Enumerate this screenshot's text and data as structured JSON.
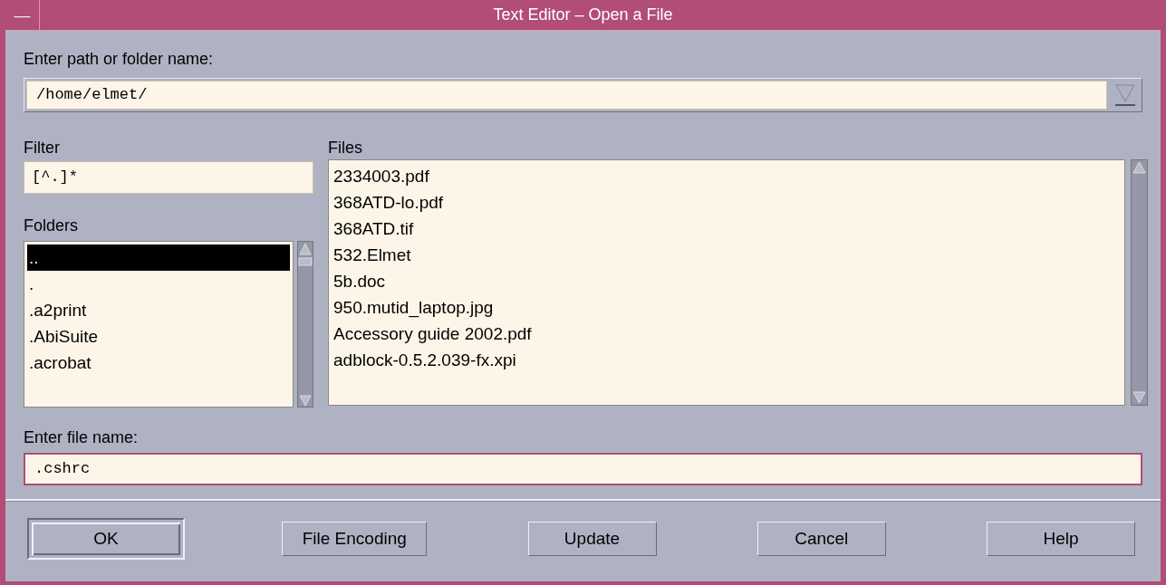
{
  "window": {
    "title": "Text Editor – Open a File",
    "menu_button": "—"
  },
  "path": {
    "label": "Enter path or folder name:",
    "value": "/home/elmet/"
  },
  "filter": {
    "label": "Filter",
    "value": "[^.]*"
  },
  "folders": {
    "label": "Folders",
    "items": [
      {
        "name": "..",
        "selected": true
      },
      {
        "name": ".",
        "selected": false
      },
      {
        "name": ".a2print",
        "selected": false
      },
      {
        "name": ".AbiSuite",
        "selected": false
      },
      {
        "name": ".acrobat",
        "selected": false
      }
    ]
  },
  "files": {
    "label": "Files",
    "items": [
      {
        "name": "2334003.pdf",
        "selected": false
      },
      {
        "name": "368ATD-lo.pdf",
        "selected": false
      },
      {
        "name": "368ATD.tif",
        "selected": false
      },
      {
        "name": "532.Elmet",
        "selected": false
      },
      {
        "name": "5b.doc",
        "selected": false
      },
      {
        "name": "950.mutid_laptop.jpg",
        "selected": false
      },
      {
        "name": "Accessory guide 2002.pdf",
        "selected": false
      },
      {
        "name": "adblock-0.5.2.039-fx.xpi",
        "selected": false
      }
    ]
  },
  "file_name": {
    "label": "Enter file name:",
    "value": ".cshrc"
  },
  "buttons": [
    {
      "label": "OK",
      "default": true
    },
    {
      "label": "File Encoding",
      "default": false
    },
    {
      "label": "Update",
      "default": false
    },
    {
      "label": "Cancel",
      "default": false
    },
    {
      "label": "Help",
      "default": false
    }
  ]
}
